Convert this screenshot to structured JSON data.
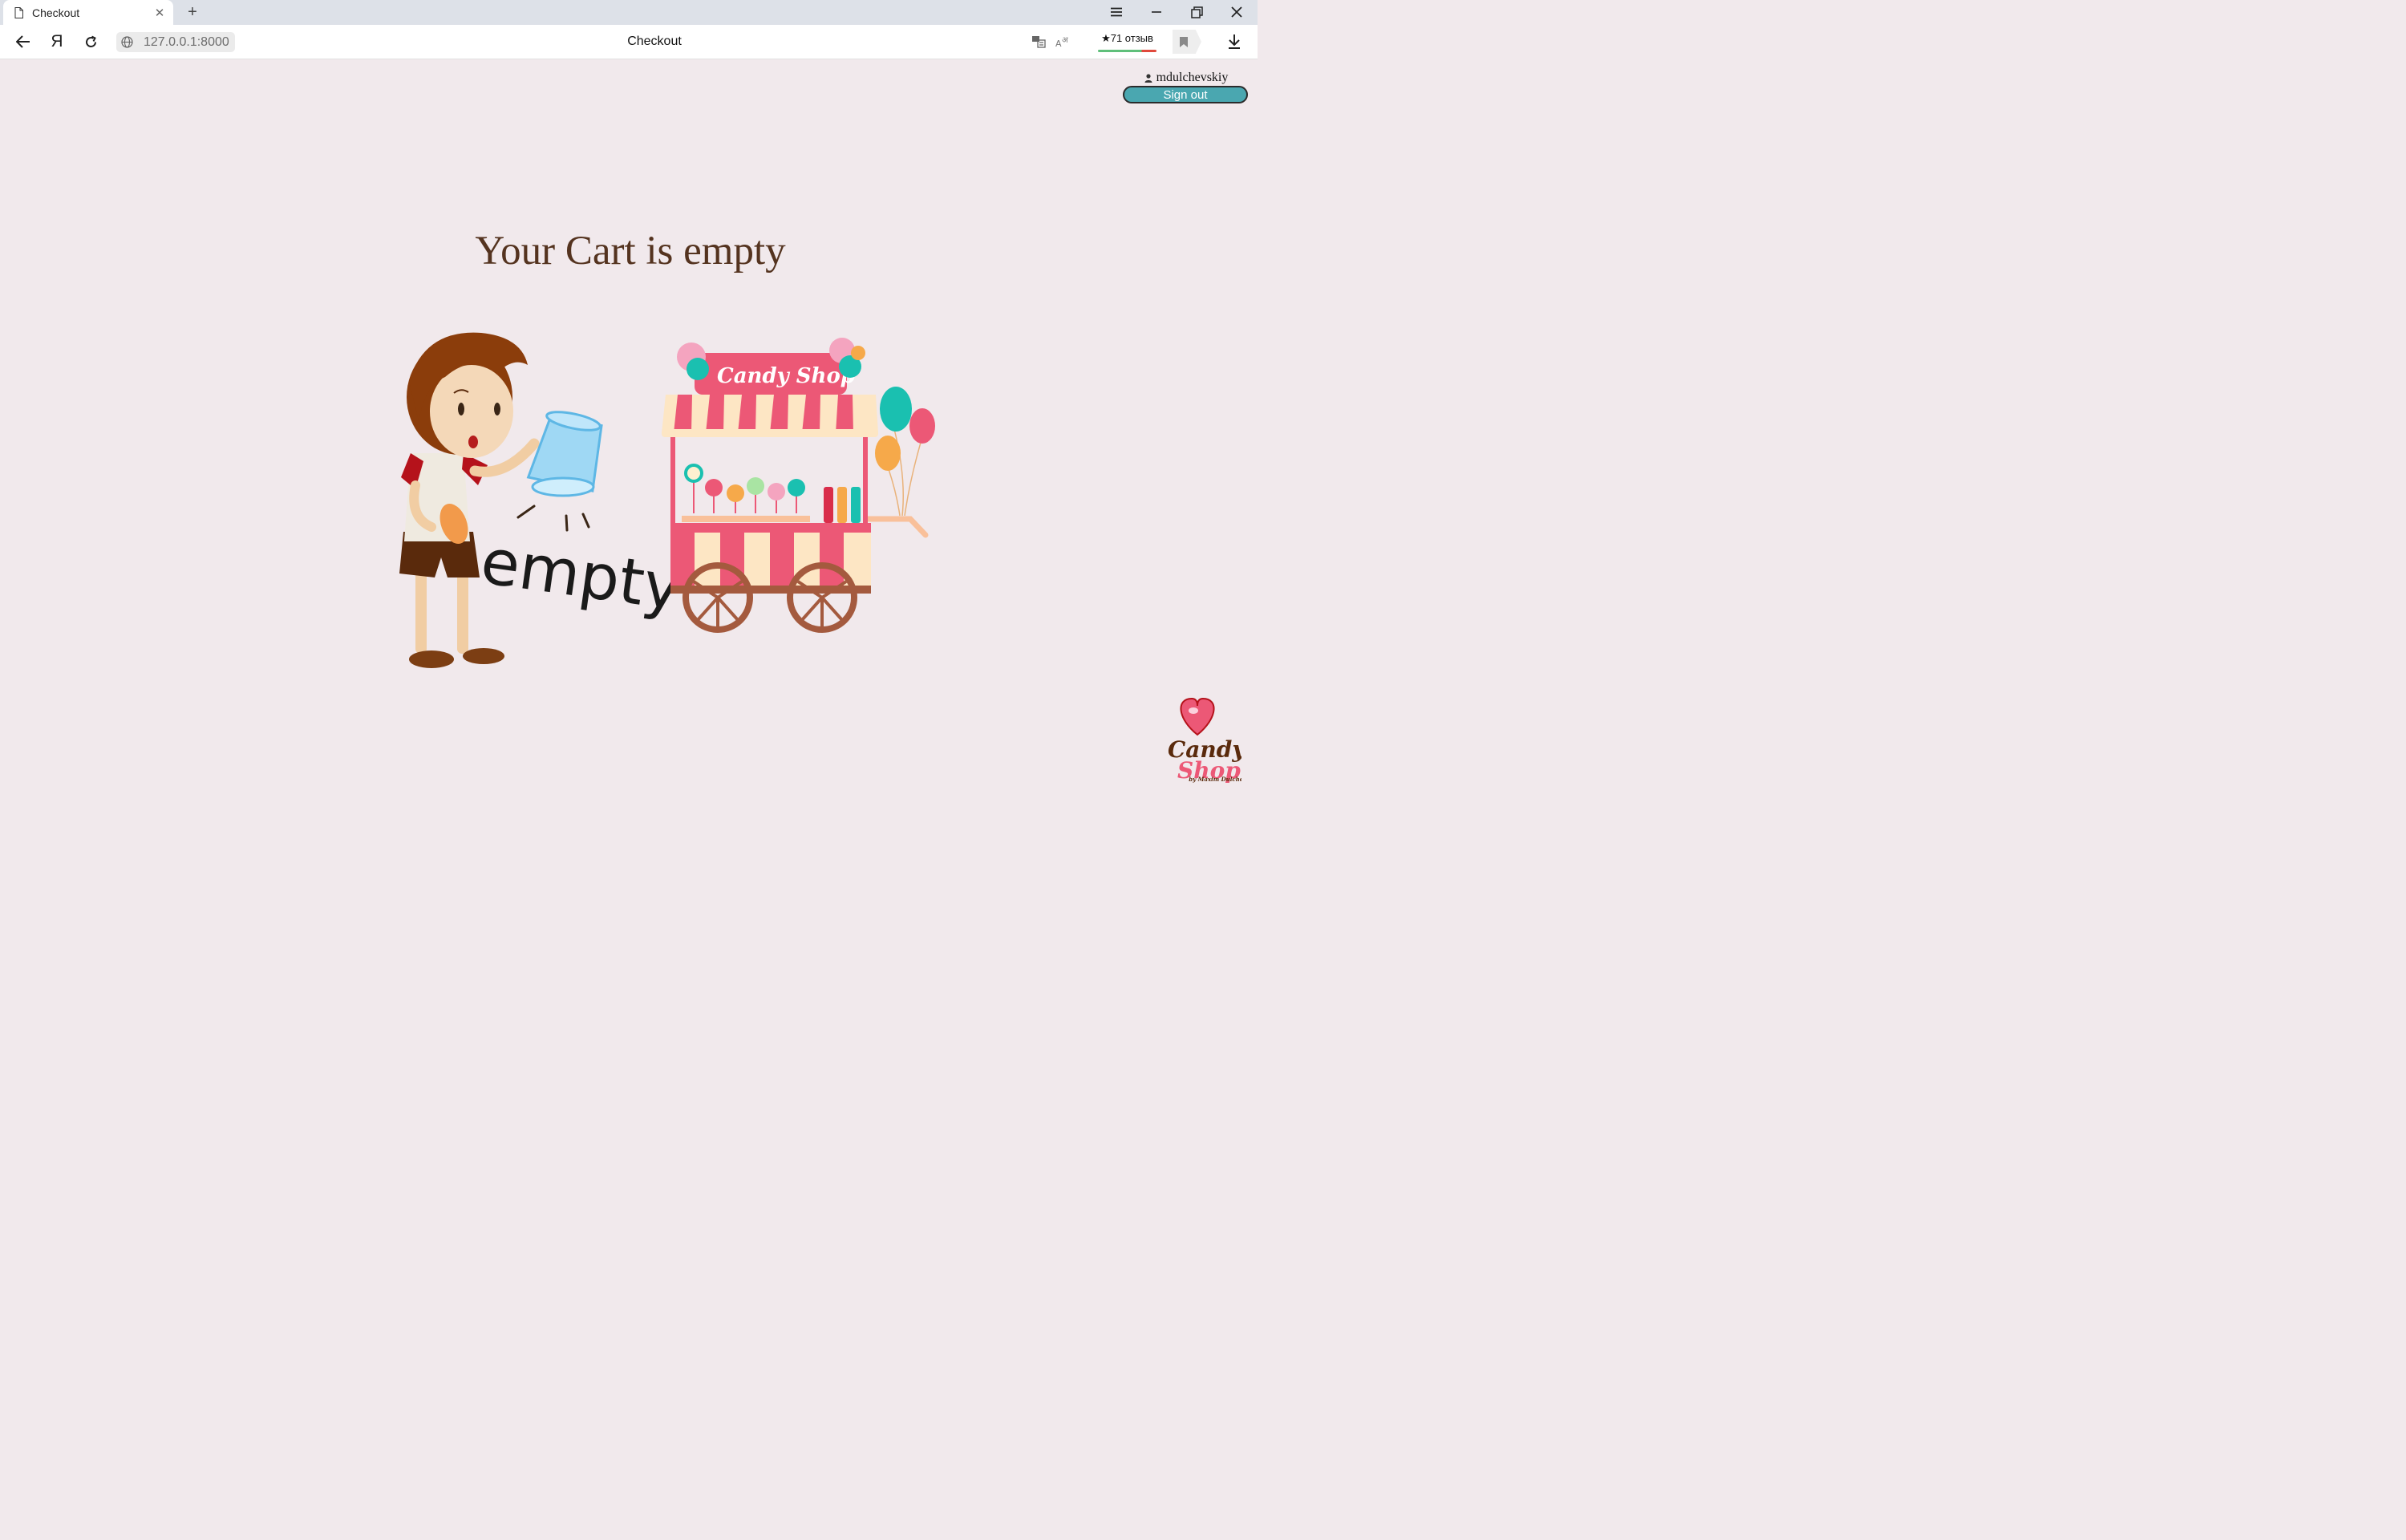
{
  "browser": {
    "tab_title": "Checkout",
    "new_tab_symbol": "+",
    "close_tab_symbol": "✕",
    "yandex_symbol": "Я",
    "url": "127.0.0.1:8000",
    "center_title": "Checkout",
    "reviews_label": "★71 отзыв"
  },
  "user": {
    "username": "mdulchevskiy",
    "signout_label": "Sign out"
  },
  "main": {
    "heading": "Your Cart is empty",
    "illustration_word": "empty",
    "cart_sign": "Candy Shop"
  },
  "logo": {
    "line1": "Candy",
    "line2": "Shop",
    "byline": "by Maxim Dulchevskiy"
  },
  "colors": {
    "page_bg": "#f1e9ec",
    "heading": "#54331f",
    "signout_bg": "#4aa7b0",
    "cart_pink": "#ec5876",
    "cart_cream": "#fde6c4"
  }
}
